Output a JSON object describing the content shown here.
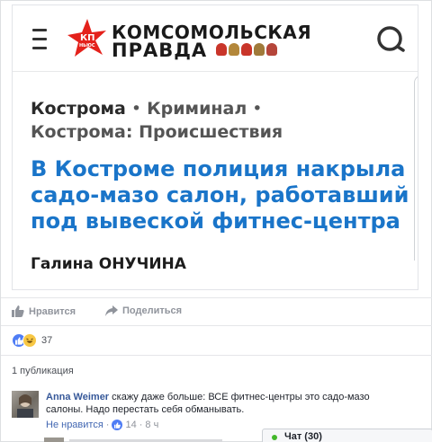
{
  "preview": {
    "logo": {
      "line1": "КОМСОМОЛЬСКАЯ",
      "line2": "ПРАВДА",
      "badge": "КП",
      "badge_sub": "НЬЮС",
      "star_color": "#e4211b"
    },
    "breadcrumbs": [
      {
        "label": "Кострома"
      },
      {
        "label": "Криминал"
      },
      {
        "label": "Кострома: Происшествия"
      }
    ],
    "separator": "•",
    "headline": "В Костроме полиция накрыла садо-мазо салон, работавший под вывеской фитнес-центра",
    "author": "Галина ОНУЧИНА",
    "headline_color": "#1a75c9"
  },
  "actions": {
    "like_label": "Нравится",
    "share_label": "Поделиться"
  },
  "reactions": {
    "count": "37",
    "icons": [
      "like-icon",
      "haha-icon"
    ]
  },
  "publications": {
    "label": "1 публикация"
  },
  "comment": {
    "author": "Anna Weimer",
    "text": "скажу даже больше: ВСЕ фитнес-центры это садо-мазо салоны. Надо перестать себя обманывать.",
    "unlike_label": "Не нравится",
    "separator": "·",
    "likes": "14",
    "time": "8 ч"
  },
  "chat": {
    "label": "Чат (30)",
    "status_color": "#42b72a"
  },
  "colors": {
    "facebook_blue": "#4267b2",
    "link_blue": "#365899",
    "meta_gray": "#90949c"
  }
}
